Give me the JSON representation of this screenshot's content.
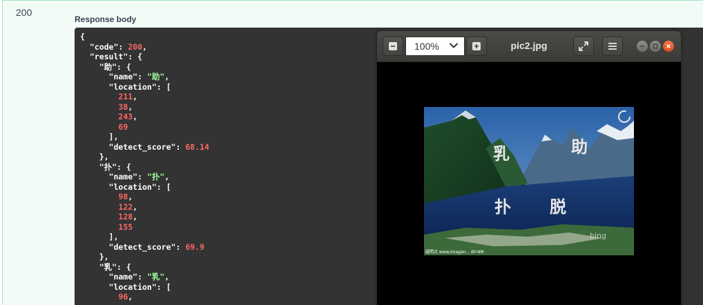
{
  "response": {
    "status_code": "200",
    "body_label": "Response body",
    "json_lines": [
      [
        {
          "t": "p",
          "v": "{"
        }
      ],
      [
        {
          "t": "p",
          "v": "  \"code\": "
        },
        {
          "t": "n",
          "v": "200"
        },
        {
          "t": "p",
          "v": ","
        }
      ],
      [
        {
          "t": "p",
          "v": "  \"result\": {"
        }
      ],
      [
        {
          "t": "p",
          "v": "    \"助\": {"
        }
      ],
      [
        {
          "t": "p",
          "v": "      \"name\": "
        },
        {
          "t": "s",
          "v": "\"助\""
        },
        {
          "t": "p",
          "v": ","
        }
      ],
      [
        {
          "t": "p",
          "v": "      \"location\": ["
        }
      ],
      [
        {
          "t": "p",
          "v": "        "
        },
        {
          "t": "n",
          "v": "211"
        },
        {
          "t": "p",
          "v": ","
        }
      ],
      [
        {
          "t": "p",
          "v": "        "
        },
        {
          "t": "n",
          "v": "38"
        },
        {
          "t": "p",
          "v": ","
        }
      ],
      [
        {
          "t": "p",
          "v": "        "
        },
        {
          "t": "n",
          "v": "243"
        },
        {
          "t": "p",
          "v": ","
        }
      ],
      [
        {
          "t": "p",
          "v": "        "
        },
        {
          "t": "n",
          "v": "69"
        }
      ],
      [
        {
          "t": "p",
          "v": "      ],"
        }
      ],
      [
        {
          "t": "p",
          "v": "      \"detect_score\": "
        },
        {
          "t": "n",
          "v": "68.14"
        }
      ],
      [
        {
          "t": "p",
          "v": "    },"
        }
      ],
      [
        {
          "t": "p",
          "v": "    \"扑\": {"
        }
      ],
      [
        {
          "t": "p",
          "v": "      \"name\": "
        },
        {
          "t": "s",
          "v": "\"扑\""
        },
        {
          "t": "p",
          "v": ","
        }
      ],
      [
        {
          "t": "p",
          "v": "      \"location\": ["
        }
      ],
      [
        {
          "t": "p",
          "v": "        "
        },
        {
          "t": "n",
          "v": "98"
        },
        {
          "t": "p",
          "v": ","
        }
      ],
      [
        {
          "t": "p",
          "v": "        "
        },
        {
          "t": "n",
          "v": "122"
        },
        {
          "t": "p",
          "v": ","
        }
      ],
      [
        {
          "t": "p",
          "v": "        "
        },
        {
          "t": "n",
          "v": "128"
        },
        {
          "t": "p",
          "v": ","
        }
      ],
      [
        {
          "t": "p",
          "v": "        "
        },
        {
          "t": "n",
          "v": "155"
        }
      ],
      [
        {
          "t": "p",
          "v": "      ],"
        }
      ],
      [
        {
          "t": "p",
          "v": "      \"detect_score\": "
        },
        {
          "t": "n",
          "v": "69.9"
        }
      ],
      [
        {
          "t": "p",
          "v": "    },"
        }
      ],
      [
        {
          "t": "p",
          "v": "    \"乳\": {"
        }
      ],
      [
        {
          "t": "p",
          "v": "      \"name\": "
        },
        {
          "t": "s",
          "v": "\"乳\""
        },
        {
          "t": "p",
          "v": ","
        }
      ],
      [
        {
          "t": "p",
          "v": "      \"location\": ["
        }
      ],
      [
        {
          "t": "p",
          "v": "        "
        },
        {
          "t": "n",
          "v": "96"
        },
        {
          "t": "p",
          "v": ","
        }
      ]
    ]
  },
  "viewer": {
    "title": "pic2.jpg",
    "zoom": "100%",
    "toolbar_icons": [
      "zoom-out-icon",
      "chevron-down-icon",
      "zoom-in-icon",
      "fullscreen-icon",
      "menu-icon"
    ],
    "window_controls": [
      "minimize",
      "maximize",
      "close"
    ],
    "image_chars": {
      "c1": "乳",
      "c2": "助",
      "c3": "扑",
      "c4": "脱"
    },
    "watermark": "bing",
    "caption_left": "疑問点 www.imagen... BY-NM"
  },
  "colors": {
    "json_bg": "#333333",
    "json_number": "#fc6666",
    "json_string": "#a2fca2",
    "success_green": "#49cc90",
    "close_button": "#df4b16"
  }
}
